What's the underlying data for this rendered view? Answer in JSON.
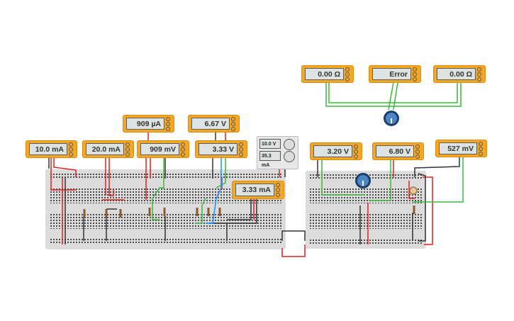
{
  "meters": {
    "m1": "10.0 mA",
    "m2": "20.0 mA",
    "m3": "909 µA",
    "m4": "909 mV",
    "m5": "6.67 V",
    "m6": "3.33 V",
    "m7": "3.33 mA",
    "top1": "0.00 Ω",
    "top2": "Error",
    "top3": "0.00 Ω",
    "b1": "3.20 V",
    "b2": "6.80 V",
    "b3": "527 mV"
  },
  "power_supply": {
    "voltage": "10.0 V",
    "current": "35.3 mA"
  },
  "colors": {
    "meter": "#f5a623",
    "wire_red": "#e02020",
    "wire_black": "#333333",
    "wire_green": "#3cb83c",
    "wire_blue": "#1e90ff",
    "potentiometer": "#4a86c8"
  }
}
